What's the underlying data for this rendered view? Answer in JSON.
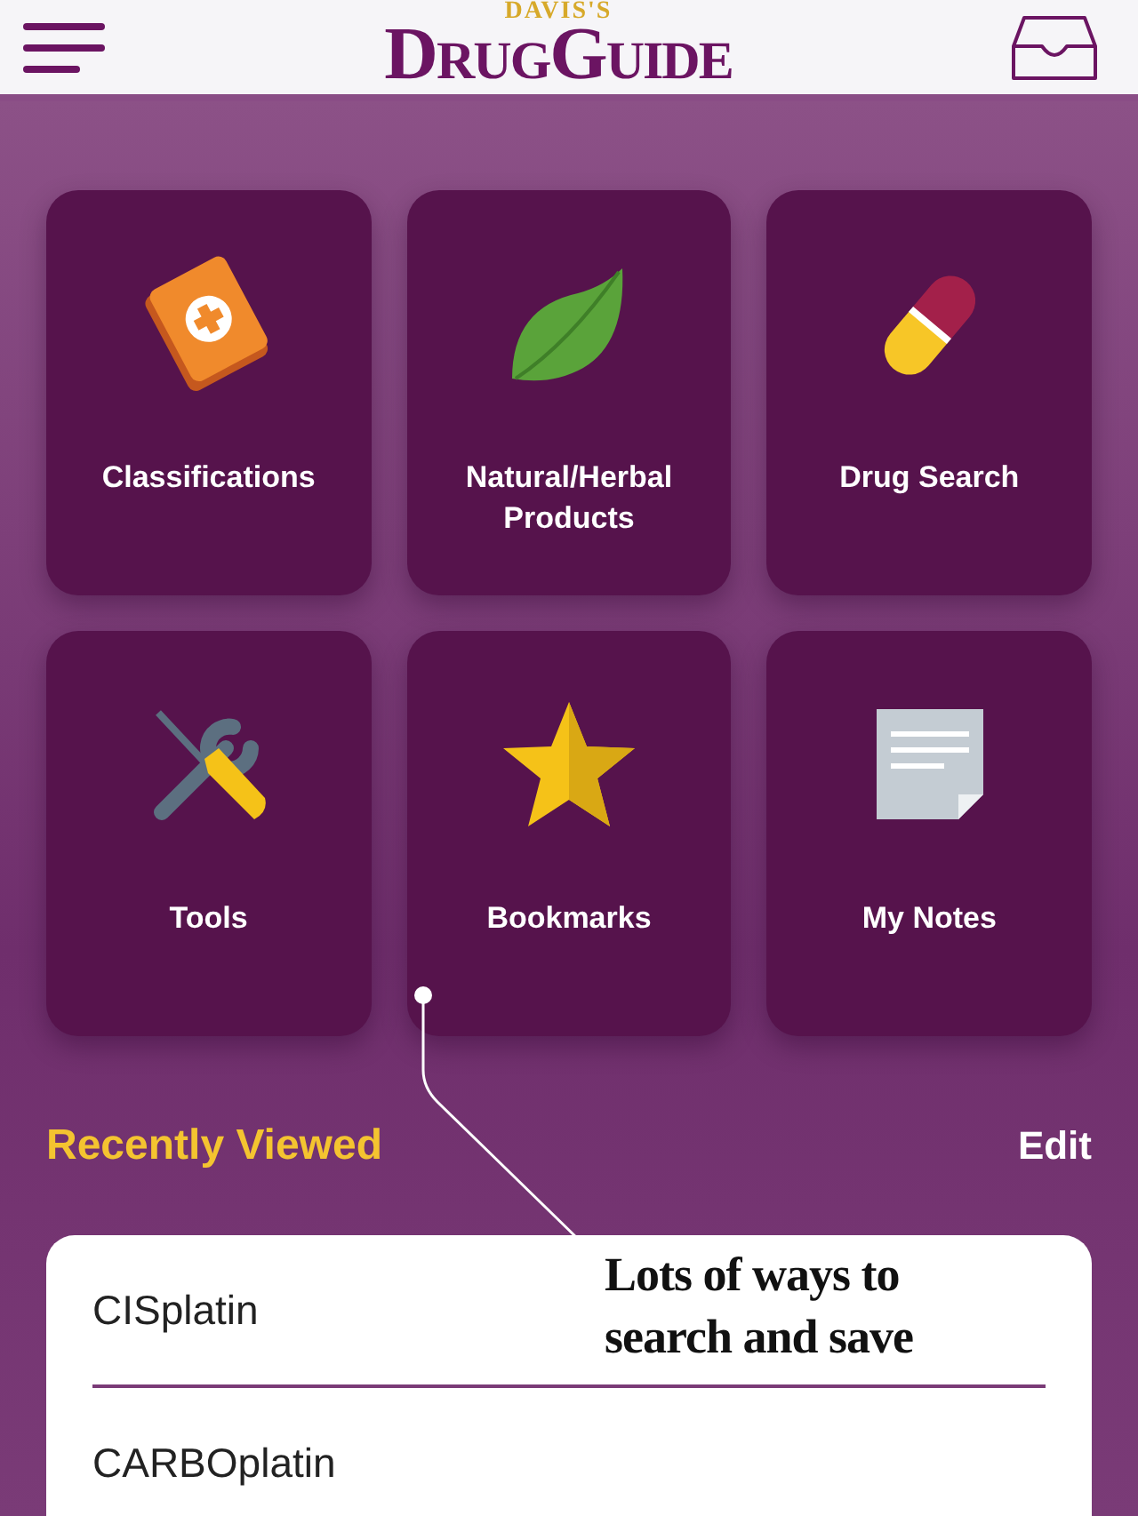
{
  "header": {
    "logo_top": "DAVIS'S",
    "logo_words": [
      "DRUG",
      "GUIDE"
    ]
  },
  "tiles": [
    {
      "label": "Classifications",
      "kind": "book"
    },
    {
      "label": "Natural/Herbal Products",
      "kind": "leaf"
    },
    {
      "label": "Drug Search",
      "kind": "capsule"
    },
    {
      "label": "Tools",
      "kind": "tools"
    },
    {
      "label": "Bookmarks",
      "kind": "star"
    },
    {
      "label": "My Notes",
      "kind": "note"
    }
  ],
  "recent": {
    "title": "Recently Viewed",
    "edit": "Edit",
    "items": [
      "CISplatin",
      "CARBOplatin"
    ]
  },
  "annotation": "Lots of ways to search and save"
}
